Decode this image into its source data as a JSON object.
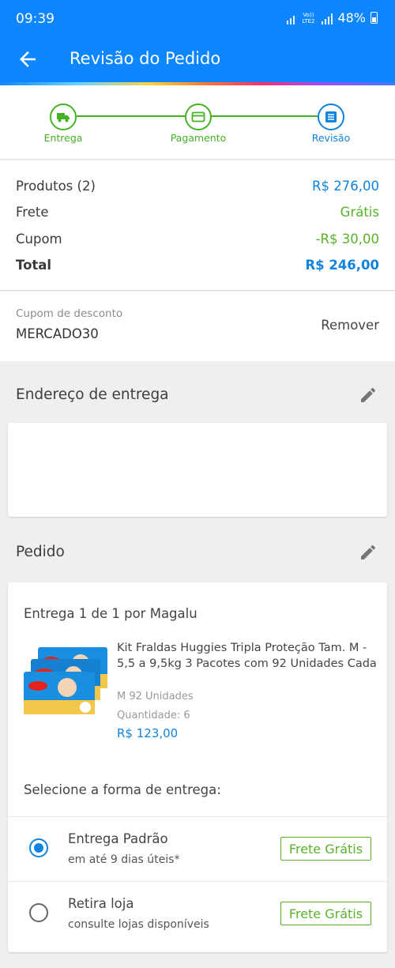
{
  "status_bar": {
    "time": "09:39",
    "network": "Vo)) LTE2",
    "battery": "48%"
  },
  "header": {
    "title": "Revisão do Pedido"
  },
  "steps": [
    {
      "label": "Entrega",
      "icon": "truck-icon"
    },
    {
      "label": "Pagamento",
      "icon": "card-icon"
    },
    {
      "label": "Revisão",
      "icon": "list-icon"
    }
  ],
  "summary": {
    "products_label": "Produtos (2)",
    "products_value": "R$ 276,00",
    "shipping_label": "Frete",
    "shipping_value": "Grátis",
    "coupon_label": "Cupom",
    "coupon_value": "-R$ 30,00",
    "total_label": "Total",
    "total_value": "R$ 246,00"
  },
  "coupon": {
    "label": "Cupom de desconto",
    "code": "MERCADO30",
    "remove_label": "Remover"
  },
  "address": {
    "title": "Endereço de entrega"
  },
  "order": {
    "title": "Pedido",
    "delivery_title": "Entrega 1 de 1 por Magalu",
    "product": {
      "name": "Kit Fraldas Huggies Tripla Proteção Tam. M - 5,5 a 9,5kg 3 Pacotes com 92 Unidades Cada",
      "variant": "M 92 Unidades",
      "quantity": "Quantidade:  6",
      "price": "R$ 123,00"
    },
    "select_label": "Selecione a forma de entrega:",
    "options": [
      {
        "name": "Entrega Padrão",
        "detail": "em até 9 dias úteis*",
        "badge": "Frete Grátis",
        "selected": true
      },
      {
        "name": "Retira loja",
        "detail": "consulte lojas disponíveis",
        "badge": "Frete Grátis",
        "selected": false
      }
    ]
  },
  "colors": {
    "primary": "#0d86ff",
    "accent_blue": "#0f83e0",
    "green": "#58b32a"
  }
}
